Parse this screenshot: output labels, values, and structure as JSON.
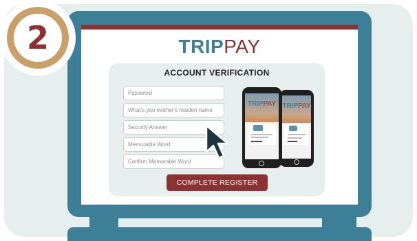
{
  "step": {
    "number": "2"
  },
  "brand": {
    "trip": "TRIP",
    "pay": "PAY"
  },
  "form": {
    "title": "ACCOUNT VERIFICATION",
    "fields": [
      {
        "placeholder": "Password"
      },
      {
        "placeholder": "What's you mother's maiden name"
      },
      {
        "placeholder": "Security Answer"
      },
      {
        "placeholder": "Memorable Word"
      },
      {
        "placeholder": "Confirm Memorable Word"
      }
    ],
    "submit_label": "COMPLETE REGISTER"
  },
  "phones": [
    {
      "brand_trip": "TRIP",
      "brand_pay": "PAY"
    },
    {
      "brand_trip": "TRIP",
      "brand_pay": "PAY"
    }
  ],
  "colors": {
    "primary_teal": "#3d7f96",
    "accent_maroon": "#8e3133",
    "badge_gold": "#c9a068",
    "panel_bg": "#e7eeee"
  },
  "icons": {
    "cursor": "mouse-pointer-icon"
  }
}
